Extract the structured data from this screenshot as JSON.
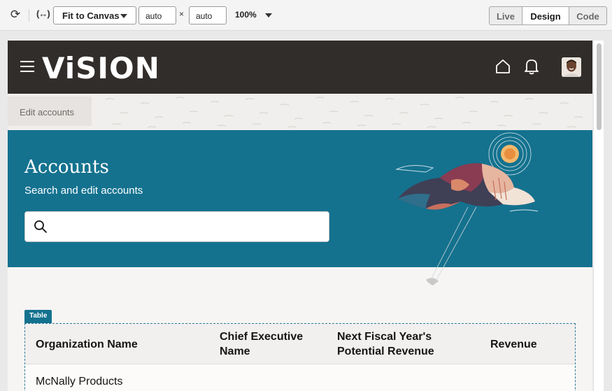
{
  "toolbar": {
    "refresh_icon": "refresh-icon",
    "fit_icon": "(↔)",
    "fit_select": "Fit to Canvas",
    "width_value": "auto",
    "times": "×",
    "height_value": "auto",
    "zoom": "100%",
    "modes": [
      "Live",
      "Design",
      "Code"
    ],
    "active_mode": "Design"
  },
  "app": {
    "logo": "ViSION",
    "header_color": "#312d2a",
    "breadcrumb": "Edit accounts"
  },
  "hero": {
    "title": "Accounts",
    "subtitle": "Search and edit accounts",
    "search_placeholder": "",
    "search_value": "",
    "color": "#14728f"
  },
  "table": {
    "badge": "Table",
    "columns": [
      "Organization Name",
      "Chief Executive Name",
      "Next Fiscal Year's Potential Revenue",
      "Revenue"
    ],
    "rows": [
      [
        "McNally Products",
        "",
        "",
        ""
      ]
    ]
  }
}
